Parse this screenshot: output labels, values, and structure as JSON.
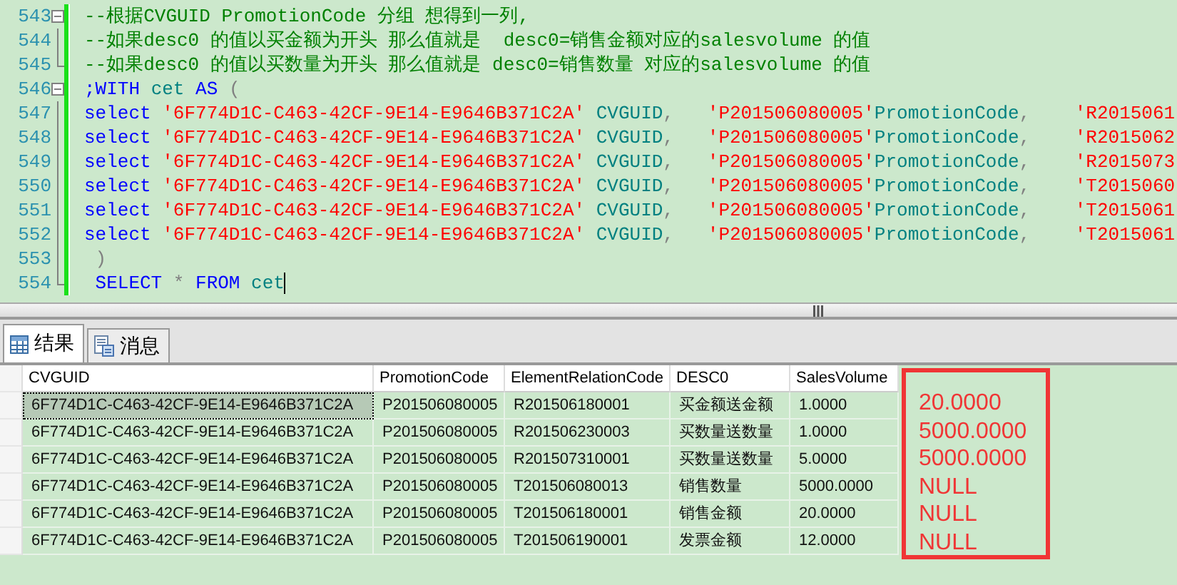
{
  "editor": {
    "lines": [
      {
        "number": "543",
        "kind": "start",
        "cursor": false,
        "tokens": [
          {
            "kind": "comment",
            "text": "--根据CVGUID PromotionCode 分组 想得到一列,"
          }
        ]
      },
      {
        "number": "544",
        "kind": "middle",
        "cursor": false,
        "tokens": [
          {
            "kind": "comment",
            "text": "--如果desc0 的值以买金额为开头 那么值就是  desc0=销售金额对应的salesvolume 的值"
          }
        ]
      },
      {
        "number": "545",
        "kind": "end",
        "cursor": false,
        "tokens": [
          {
            "kind": "comment",
            "text": "--如果desc0 的值以买数量为开头 那么值就是 desc0=销售数量 对应的salesvolume 的值"
          }
        ]
      },
      {
        "number": "546",
        "kind": "start",
        "cursor": false,
        "tokens": [
          {
            "kind": "keyword",
            "text": ";WITH "
          },
          {
            "kind": "ident",
            "text": "cet "
          },
          {
            "kind": "keyword",
            "text": "AS "
          },
          {
            "kind": "plain",
            "text": "("
          }
        ]
      },
      {
        "number": "547",
        "kind": "middle",
        "cursor": false,
        "tokens": [
          {
            "kind": "keyword",
            "text": "select "
          },
          {
            "kind": "string",
            "text": "'6F774D1C-C463-42CF-9E14-E9646B371C2A' "
          },
          {
            "kind": "ident",
            "text": "CVGUID"
          },
          {
            "kind": "plain",
            "text": ",   "
          },
          {
            "kind": "string",
            "text": "'P201506080005'"
          },
          {
            "kind": "ident",
            "text": "PromotionCode"
          },
          {
            "kind": "plain",
            "text": ",    "
          },
          {
            "kind": "string",
            "text": "'R2015061"
          }
        ]
      },
      {
        "number": "548",
        "kind": "middle",
        "cursor": false,
        "tokens": [
          {
            "kind": "keyword",
            "text": "select "
          },
          {
            "kind": "string",
            "text": "'6F774D1C-C463-42CF-9E14-E9646B371C2A' "
          },
          {
            "kind": "ident",
            "text": "CVGUID"
          },
          {
            "kind": "plain",
            "text": ",   "
          },
          {
            "kind": "string",
            "text": "'P201506080005'"
          },
          {
            "kind": "ident",
            "text": "PromotionCode"
          },
          {
            "kind": "plain",
            "text": ",    "
          },
          {
            "kind": "string",
            "text": "'R2015062"
          }
        ]
      },
      {
        "number": "549",
        "kind": "middle",
        "cursor": false,
        "tokens": [
          {
            "kind": "keyword",
            "text": "select "
          },
          {
            "kind": "string",
            "text": "'6F774D1C-C463-42CF-9E14-E9646B371C2A' "
          },
          {
            "kind": "ident",
            "text": "CVGUID"
          },
          {
            "kind": "plain",
            "text": ",   "
          },
          {
            "kind": "string",
            "text": "'P201506080005'"
          },
          {
            "kind": "ident",
            "text": "PromotionCode"
          },
          {
            "kind": "plain",
            "text": ",    "
          },
          {
            "kind": "string",
            "text": "'R2015073"
          }
        ]
      },
      {
        "number": "550",
        "kind": "middle",
        "cursor": false,
        "tokens": [
          {
            "kind": "keyword",
            "text": "select "
          },
          {
            "kind": "string",
            "text": "'6F774D1C-C463-42CF-9E14-E9646B371C2A' "
          },
          {
            "kind": "ident",
            "text": "CVGUID"
          },
          {
            "kind": "plain",
            "text": ",   "
          },
          {
            "kind": "string",
            "text": "'P201506080005'"
          },
          {
            "kind": "ident",
            "text": "PromotionCode"
          },
          {
            "kind": "plain",
            "text": ",    "
          },
          {
            "kind": "string",
            "text": "'T2015060"
          }
        ]
      },
      {
        "number": "551",
        "kind": "middle",
        "cursor": false,
        "tokens": [
          {
            "kind": "keyword",
            "text": "select "
          },
          {
            "kind": "string",
            "text": "'6F774D1C-C463-42CF-9E14-E9646B371C2A' "
          },
          {
            "kind": "ident",
            "text": "CVGUID"
          },
          {
            "kind": "plain",
            "text": ",   "
          },
          {
            "kind": "string",
            "text": "'P201506080005'"
          },
          {
            "kind": "ident",
            "text": "PromotionCode"
          },
          {
            "kind": "plain",
            "text": ",    "
          },
          {
            "kind": "string",
            "text": "'T2015061"
          }
        ]
      },
      {
        "number": "552",
        "kind": "middle",
        "cursor": false,
        "tokens": [
          {
            "kind": "keyword",
            "text": "select "
          },
          {
            "kind": "string",
            "text": "'6F774D1C-C463-42CF-9E14-E9646B371C2A' "
          },
          {
            "kind": "ident",
            "text": "CVGUID"
          },
          {
            "kind": "plain",
            "text": ",   "
          },
          {
            "kind": "string",
            "text": "'P201506080005'"
          },
          {
            "kind": "ident",
            "text": "PromotionCode"
          },
          {
            "kind": "plain",
            "text": ",    "
          },
          {
            "kind": "string",
            "text": "'T2015061"
          }
        ]
      },
      {
        "number": "553",
        "kind": "middle",
        "cursor": false,
        "tokens": [
          {
            "kind": "plain",
            "text": " )"
          }
        ]
      },
      {
        "number": "554",
        "kind": "end",
        "cursor": true,
        "tokens": [
          {
            "kind": "keyword",
            "text": " SELECT"
          },
          {
            "kind": "plain",
            "text": " * "
          },
          {
            "kind": "keyword",
            "text": "FROM "
          },
          {
            "kind": "ident",
            "text": "cet"
          }
        ]
      }
    ]
  },
  "result_tabs": [
    {
      "label": "结果",
      "selected": true
    },
    {
      "label": "消息",
      "selected": false
    }
  ],
  "grid": {
    "columns": [
      "CVGUID",
      "PromotionCode",
      "ElementRelationCode",
      "DESC0",
      "SalesVolume"
    ],
    "rows": [
      {
        "selected": true,
        "cells": [
          "6F774D1C-C463-42CF-9E14-E9646B371C2A",
          "P201506080005",
          "R201506180001",
          "买金额送金额",
          "1.0000"
        ]
      },
      {
        "selected": false,
        "cells": [
          "6F774D1C-C463-42CF-9E14-E9646B371C2A",
          "P201506080005",
          "R201506230003",
          "买数量送数量",
          "1.0000"
        ]
      },
      {
        "selected": false,
        "cells": [
          "6F774D1C-C463-42CF-9E14-E9646B371C2A",
          "P201506080005",
          "R201507310001",
          "买数量送数量",
          "5.0000"
        ]
      },
      {
        "selected": false,
        "cells": [
          "6F774D1C-C463-42CF-9E14-E9646B371C2A",
          "P201506080005",
          "T201506080013",
          "销售数量",
          "5000.0000"
        ]
      },
      {
        "selected": false,
        "cells": [
          "6F774D1C-C463-42CF-9E14-E9646B371C2A",
          "P201506080005",
          "T201506180001",
          "销售金额",
          "20.0000"
        ]
      },
      {
        "selected": false,
        "cells": [
          "6F774D1C-C463-42CF-9E14-E9646B371C2A",
          "P201506080005",
          "T201506190001",
          "发票金额",
          "12.0000"
        ]
      }
    ]
  },
  "annotation": {
    "values": [
      "20.0000",
      "5000.0000",
      "5000.0000",
      "NULL",
      "NULL",
      "NULL"
    ]
  }
}
